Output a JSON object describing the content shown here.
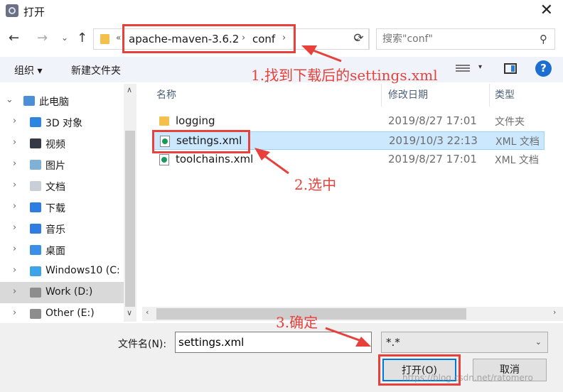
{
  "window": {
    "title": "打开",
    "close_glyph": "✕"
  },
  "nav": {
    "back": "←",
    "forward": "→",
    "recent": "⌄",
    "up": "↑",
    "crumb_prefix": "«",
    "crumbs": [
      "apache-maven-3.6.2",
      "conf"
    ],
    "crumb_sep": "›",
    "search_placeholder": "搜索\"conf\""
  },
  "toolbar": {
    "organize": "组织 ▾",
    "new_folder": "新建文件夹",
    "view_drop": "▾",
    "help": "?"
  },
  "sidebar": {
    "items": [
      {
        "label": "此电脑",
        "icon": "computer-icon",
        "arrow": "⌄",
        "color": "#4a8fd8"
      },
      {
        "label": "3D 对象",
        "icon": "cube-icon",
        "arrow": "›",
        "color": "#2e84e0"
      },
      {
        "label": "视频",
        "icon": "video-icon",
        "arrow": "›",
        "color": "#333a45"
      },
      {
        "label": "图片",
        "icon": "pictures-icon",
        "arrow": "›",
        "color": "#7fb0d6"
      },
      {
        "label": "文档",
        "icon": "documents-icon",
        "arrow": "›",
        "color": "#c9cfd6"
      },
      {
        "label": "下载",
        "icon": "downloads-icon",
        "arrow": "›",
        "color": "#2f7de0"
      },
      {
        "label": "音乐",
        "icon": "music-icon",
        "arrow": "›",
        "color": "#2f7de0"
      },
      {
        "label": "桌面",
        "icon": "desktop-icon",
        "arrow": "›",
        "color": "#3d8fe6"
      },
      {
        "label": "Windows10 (C:",
        "icon": "windows-drive-icon",
        "arrow": "›",
        "color": "#3fa3e6"
      },
      {
        "label": "Work (D:)",
        "icon": "drive-icon",
        "arrow": "›",
        "color": "#8d8d8d"
      },
      {
        "label": "Other (E:)",
        "icon": "drive-icon",
        "arrow": "›",
        "color": "#8d8d8d"
      }
    ],
    "selected_index": 9
  },
  "filelist": {
    "headers": {
      "name": "名称",
      "date": "修改日期",
      "type": "类型"
    },
    "files": [
      {
        "name": "logging",
        "date": "2019/8/27 17:01",
        "type": "文件夹",
        "kind": "folder"
      },
      {
        "name": "settings.xml",
        "date": "2019/10/3 22:13",
        "type": "XML 文档",
        "kind": "xml"
      },
      {
        "name": "toolchains.xml",
        "date": "2019/8/27 17:01",
        "type": "XML 文档",
        "kind": "xml"
      }
    ],
    "selected_index": 1
  },
  "bottom": {
    "filename_label": "文件名(N):",
    "filename_value": "settings.xml",
    "filetype_value": "*.*",
    "open_label": "打开(O)",
    "cancel_label": "取消",
    "watermark": "https://blog.csdn.net/ratomero"
  },
  "annotations": {
    "step1": "1.找到下载后的settings.xml",
    "step2": "2.选中",
    "step3": "3.确定",
    "color": "#e8403a"
  }
}
